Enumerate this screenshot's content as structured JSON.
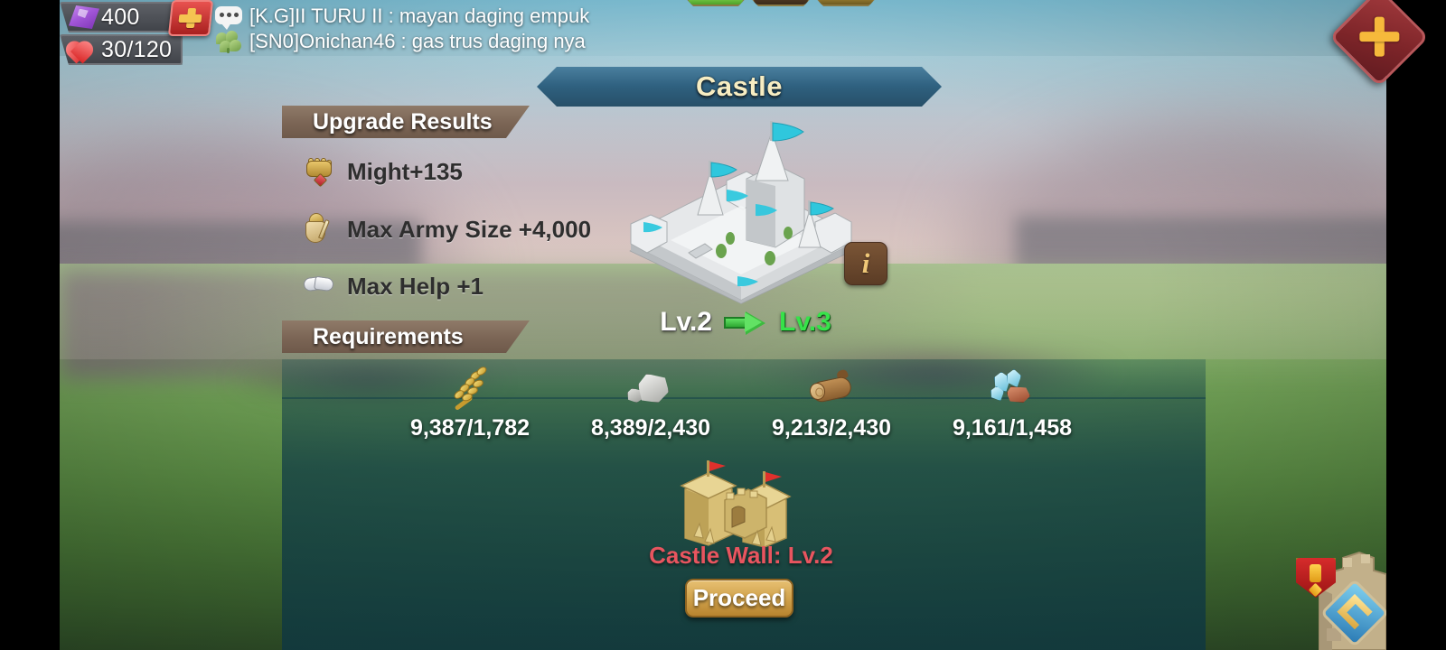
{
  "hud": {
    "gem_icon": "gem-icon",
    "gem_count": "400",
    "add_gems_label": "+",
    "hp_icon": "heart-icon",
    "hp_value": "30/120"
  },
  "chat": {
    "messages": [
      {
        "icon": "speech-bubble-icon",
        "text": "[K.G]II TURU II : mayan daging empuk"
      },
      {
        "icon": "clover-icon",
        "text": "[SN0]Onichan46 : gas trus daging nya"
      }
    ]
  },
  "close_button": {
    "icon": "close-x-icon",
    "label": "×"
  },
  "title": "Castle",
  "sections": {
    "upgrade_results_label": "Upgrade Results",
    "requirements_label": "Requirements"
  },
  "upgrade_results": [
    {
      "icon": "fist-icon",
      "label": "Might+135"
    },
    {
      "icon": "army-shield-icon",
      "label": "Max Army Size +4,000"
    },
    {
      "icon": "handshake-icon",
      "label": "Max Help +1"
    }
  ],
  "building": {
    "image": "castle-isometric",
    "info_button": "i",
    "level_from": "Lv.2",
    "level_arrow": "arrow-right-icon",
    "level_to": "Lv.3",
    "color_level_to": "#37e24a"
  },
  "requirements": [
    {
      "icon": "food-wheat-icon",
      "value": "9,387/1,782"
    },
    {
      "icon": "stone-icon",
      "value": "8,389/2,430"
    },
    {
      "icon": "wood-log-icon",
      "value": "9,213/2,430"
    },
    {
      "icon": "ore-crystal-icon",
      "value": "9,161/1,458"
    }
  ],
  "castle_wall": {
    "image": "castle-wall-gate",
    "label": "Castle Wall: Lv.2",
    "label_color": "#e8555f"
  },
  "proceed_button": {
    "label": "Proceed",
    "color": "#d2a44e"
  },
  "top_bars": [
    {
      "name": "progress-bar-green",
      "color": "#4fa229"
    },
    {
      "name": "progress-bar-dark",
      "color": "#3b2a1a"
    },
    {
      "name": "progress-bar-olive",
      "color": "#6e5a20"
    }
  ],
  "corner_badges": [
    {
      "name": "alert-shield-badge",
      "color": "#d62b2b"
    },
    {
      "name": "gem-diamond-badge",
      "color": "#2b7bb5"
    }
  ]
}
